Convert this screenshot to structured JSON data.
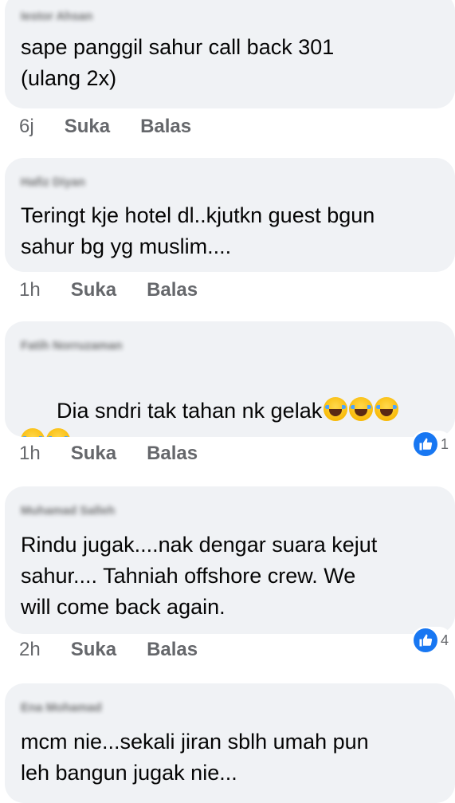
{
  "comments": [
    {
      "author": "Iestor Ahsan",
      "text": "sape panggil sahur call back 301\n(ulang 2x)",
      "emoji_count": 0,
      "time": "6j",
      "like_label": "Suka",
      "reply_label": "Balas",
      "reaction": null
    },
    {
      "author": "Hafiz Diyan",
      "text": "Teringt kje hotel dl..kjutkn guest bgun\nsahur bg yg muslim....",
      "emoji_count": 0,
      "time": "1h",
      "like_label": "Suka",
      "reply_label": "Balas",
      "reaction": null
    },
    {
      "author": "Fatih Norruzaman",
      "text": "Dia sndri tak tahan nk gelak",
      "emoji_count": 5,
      "emoji_name": "face-with-tears-of-joy",
      "time": "1h",
      "like_label": "Suka",
      "reply_label": "Balas",
      "reaction": {
        "icon": "like-icon",
        "count": "1"
      }
    },
    {
      "author": "Muhamad Salleh",
      "text": "Rindu jugak....nak dengar suara kejut\nsahur.... Tahniah offshore crew. We\nwill come back again.",
      "emoji_count": 0,
      "time": "2h",
      "like_label": "Suka",
      "reply_label": "Balas",
      "reaction": {
        "icon": "like-icon",
        "count": "4"
      }
    },
    {
      "author": "Ena Mohamad",
      "text": "mcm nie...sekali jiran sblh umah pun\nleh bangun jugak nie...",
      "emoji_count": 0,
      "time": "",
      "like_label": "",
      "reply_label": "",
      "reaction": null
    }
  ],
  "colors": {
    "bubble": "#f0f2f5",
    "text": "#050505",
    "meta": "#65676b",
    "like_blue": "#1877f2"
  }
}
